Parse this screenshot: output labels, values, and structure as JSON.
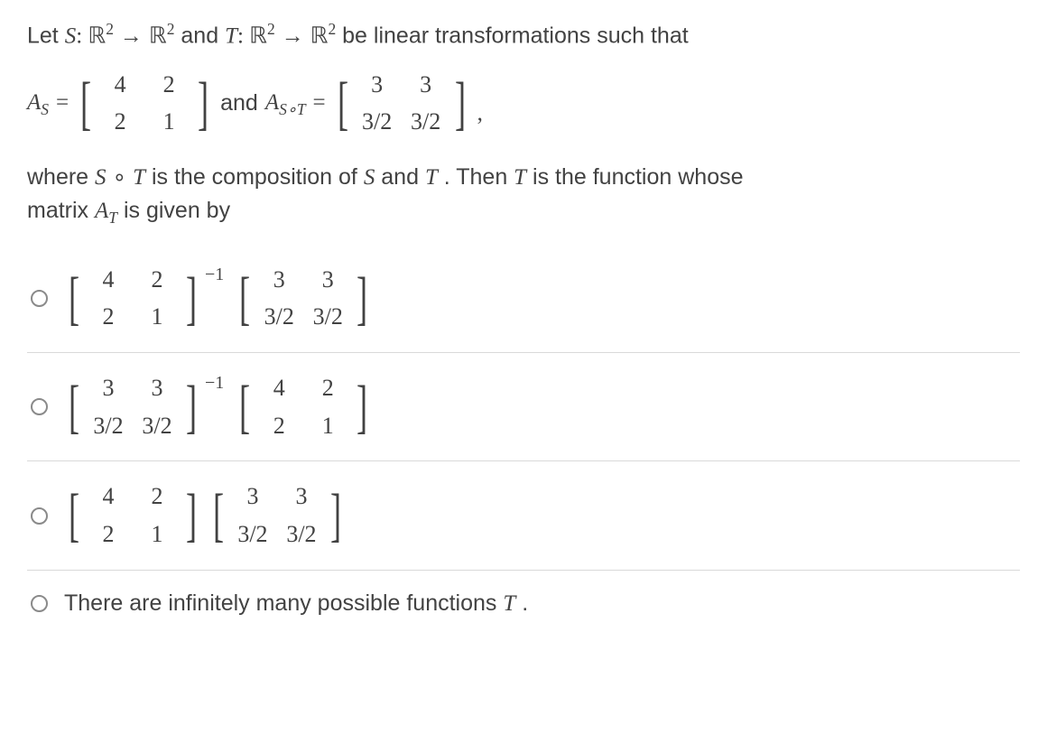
{
  "question": {
    "intro_prefix": "Let ",
    "S": "S",
    "colon": ": ",
    "R": "ℝ",
    "sq": "2",
    "arrow": "→",
    "and_word": " and ",
    "T": "T",
    "intro_suffix": " be linear transformations such that",
    "AS_lhs_A": "A",
    "AS_lhs_sub": "S",
    "eq": "=",
    "and_mid": " and ",
    "AST_lhs_A": "A",
    "AST_lhs_sub": "S∘T",
    "comma": ",",
    "where_prefix": "where ",
    "compose": "∘",
    "where_mid1": " is the composition of ",
    "where_mid2": " and ",
    "where_mid3": ". Then ",
    "where_suffix": " is the function whose",
    "matrix_line_prefix": "matrix ",
    "AT_A": "A",
    "AT_sub": "T",
    "matrix_line_suffix": " is given by"
  },
  "mat_S": {
    "r1c1": "4",
    "r1c2": "2",
    "r2c1": "2",
    "r2c2": "1"
  },
  "mat_ST": {
    "r1c1": "3",
    "r1c2": "3",
    "r2c1": "3/2",
    "r2c2": "3/2"
  },
  "inv_exp": "−1",
  "options": {
    "a": {
      "left": "mat_S",
      "left_exp": "−1",
      "right": "mat_ST"
    },
    "b": {
      "left": "mat_ST",
      "left_exp": "−1",
      "right": "mat_S"
    },
    "c": {
      "left": "mat_S",
      "right": "mat_ST"
    },
    "d": {
      "text_prefix": "There are infinitely many possible functions ",
      "T": "T",
      "period": " ."
    }
  }
}
